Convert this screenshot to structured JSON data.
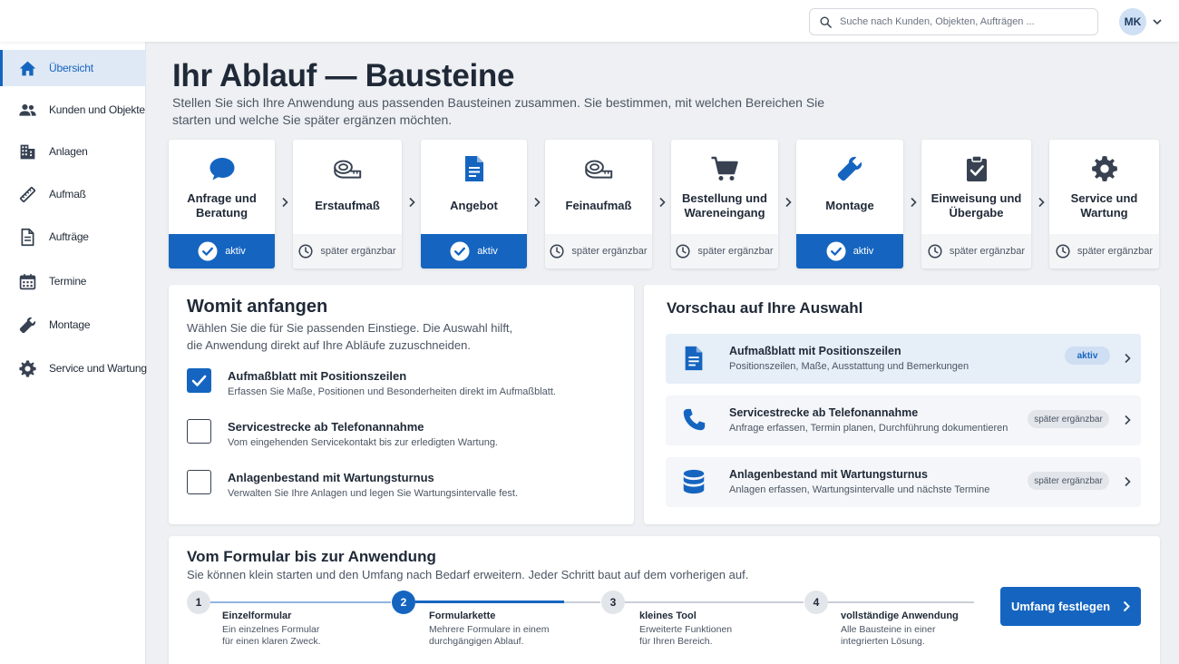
{
  "search": {
    "placeholder": "Suche nach Kunden, Objekten, Aufträgen ..."
  },
  "user": {
    "initials": "MK"
  },
  "sidebar": {
    "items": [
      {
        "label": "Übersicht",
        "icon": "home-icon",
        "active": true
      },
      {
        "label": "Kunden und Objekte",
        "icon": "people-icon"
      },
      {
        "label": "Anlagen",
        "icon": "building-icon"
      },
      {
        "label": "Aufmaß",
        "icon": "ruler-pencil-icon"
      },
      {
        "label": "Aufträge",
        "icon": "document-icon"
      },
      {
        "label": "Termine",
        "icon": "calendar-icon"
      },
      {
        "label": "Montage",
        "icon": "wrench-icon"
      },
      {
        "label": "Service und Wartung",
        "icon": "gear-icon"
      }
    ]
  },
  "header": {
    "title": "Ihr Ablauf — Bausteine",
    "subtitle": "Stellen Sie sich Ihre Anwendung aus passenden Bausteinen zusammen. Sie bestimmen, mit welchen Bereichen Sie starten und welche Sie später ergänzen möchten."
  },
  "steps": [
    {
      "label": "Anfrage und Beratung",
      "icon": "chat-bubble-icon",
      "status": "aktiv"
    },
    {
      "label": "Erstaufmaß",
      "icon": "tape-measure-icon",
      "status": "später ergänzbar"
    },
    {
      "label": "Angebot",
      "icon": "document-icon",
      "status": "aktiv"
    },
    {
      "label": "Feinaufmaß",
      "icon": "tape-measure-icon",
      "status": "später ergänzbar"
    },
    {
      "label": "Bestellung und Wareneingang",
      "icon": "cart-icon",
      "status": "später ergänzbar"
    },
    {
      "label": "Montage",
      "icon": "wrench-icon",
      "status": "aktiv"
    },
    {
      "label": "Einweisung und Übergabe",
      "icon": "clipboard-check-icon",
      "status": "später ergänzbar"
    },
    {
      "label": "Service und Wartung",
      "icon": "gear-icon",
      "status": "später ergänzbar"
    }
  ],
  "start": {
    "title": "Womit anfangen",
    "subtitle": "Wählen Sie die für Sie passenden Einstiege. Die Auswahl hilft, die Anwendung direkt auf Ihre Abläufe zuzuschneiden.",
    "options": [
      {
        "title": "Aufmaßblatt mit Positionszeilen",
        "desc": "Erfassen Sie Maße, Positionen und Besonderheiten direkt im Aufmaßblatt.",
        "checked": true
      },
      {
        "title": "Servicestrecke ab Telefonannahme",
        "desc": "Vom eingehenden Servicekontakt bis zur erledigten Wartung.",
        "checked": false
      },
      {
        "title": "Anlagenbestand mit Wartungsturnus",
        "desc": "Verwalten Sie Ihre Anlagen und legen Sie Wartungsintervalle fest.",
        "checked": false
      }
    ]
  },
  "preview": {
    "title": "Vorschau auf Ihre Auswahl",
    "items": [
      {
        "title": "Aufmaßblatt mit Positionszeilen",
        "desc": "Positionszeilen, Maße, Ausstattung und Bemerkungen",
        "badge": "aktiv",
        "icon": "document-icon"
      },
      {
        "title": "Servicestrecke ab Telefonannahme",
        "desc": "Anfrage erfassen, Termin planen, Durchführung dokumentieren",
        "badge": "später ergänzbar",
        "icon": "phone-icon"
      },
      {
        "title": "Anlagenbestand mit Wartungsturnus",
        "desc": "Anlagen erfassen, Wartungsintervalle und nächste Termine",
        "badge": "später ergänzbar",
        "icon": "database-icon"
      }
    ]
  },
  "bottom": {
    "title": "Vom Formular bis zur Anwendung",
    "subtitle": "Sie können klein starten und den Umfang nach Bedarf erweitern. Jeder Schritt baut auf dem vorherigen auf.",
    "steps": [
      {
        "num": "1",
        "title": "Einzelformular",
        "desc": "Ein einzelnes Formular für einen klaren Zweck."
      },
      {
        "num": "2",
        "title": "Formularkette",
        "desc": "Mehrere Formulare in einem durchgängigen Ablauf."
      },
      {
        "num": "3",
        "title": "kleines Tool",
        "desc": "Erweiterte Funktionen für Ihren Bereich."
      },
      {
        "num": "4",
        "title": "vollständige Anwendung",
        "desc": "Alle Bausteine in einer integrierten Lösung."
      }
    ],
    "cta": "Umfang festlegen"
  },
  "colors": {
    "accent": "#1565c0",
    "background": "#eef0f3",
    "active_nav_bg": "#dfe8f5"
  }
}
